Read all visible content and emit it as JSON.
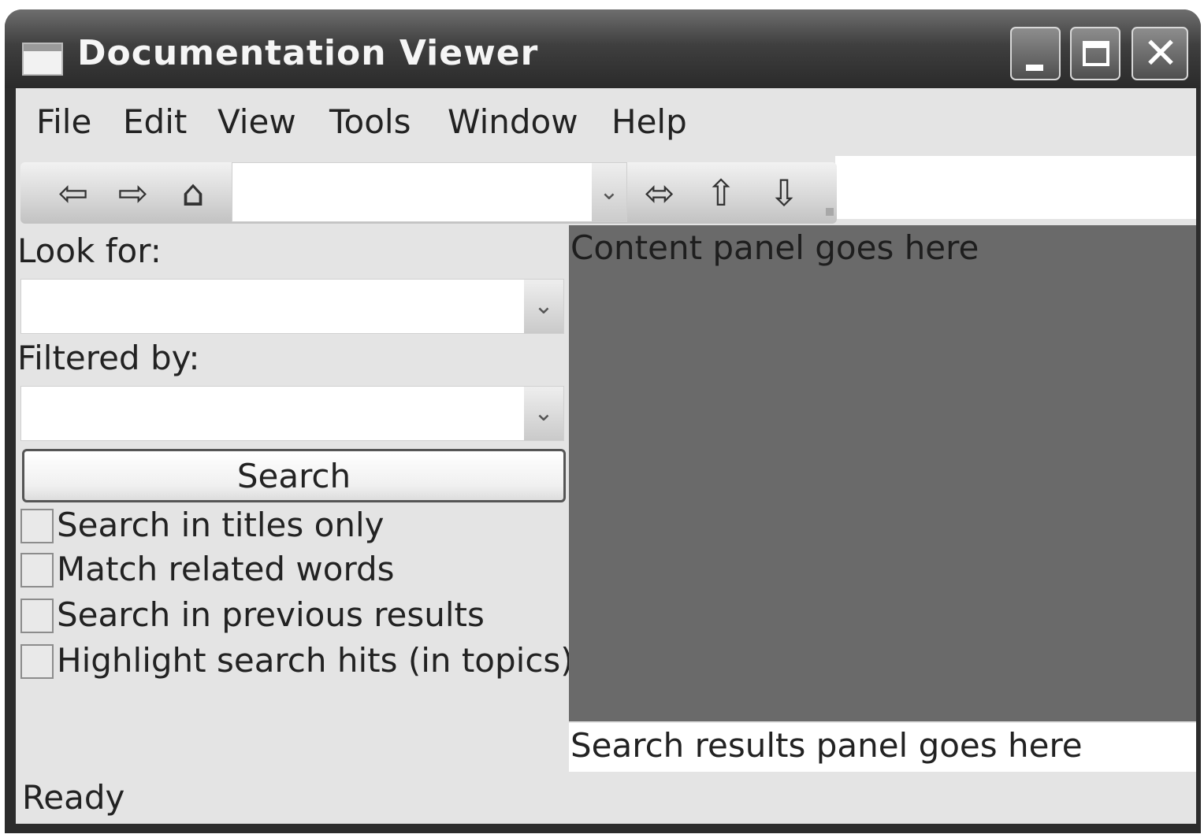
{
  "window": {
    "title": "Documentation Viewer"
  },
  "menu": [
    "File",
    "Edit",
    "View",
    "Tools",
    "Window",
    "Help"
  ],
  "toolbar": {
    "icons": [
      "back-arrow",
      "forward-arrow",
      "home",
      "sync-contents",
      "previous-topic",
      "next-topic"
    ],
    "address_value": ""
  },
  "search": {
    "look_for_label": "Look for:",
    "look_for_value": "",
    "filtered_by_label": "Filtered by:",
    "filtered_by_value": "",
    "button_label": "Search",
    "options": [
      {
        "label": "Search in titles only",
        "checked": false
      },
      {
        "label": "Match related words",
        "checked": false
      },
      {
        "label": "Search in previous results",
        "checked": false
      },
      {
        "label": "Highlight search hits (in topics)",
        "checked": false
      }
    ]
  },
  "content_panel": {
    "text": "Content panel goes here"
  },
  "results_panel": {
    "text": "Search results panel goes here"
  },
  "status": {
    "text": "Ready"
  },
  "colors": {
    "titlebar": "#3f3f3f",
    "client": "#e4e4e4",
    "content_panel": "#6a6a6a"
  }
}
